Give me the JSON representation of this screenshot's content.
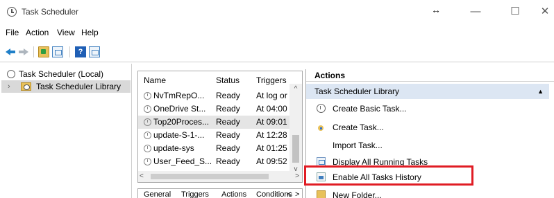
{
  "window": {
    "title": "Task Scheduler",
    "resize_glyph": "↔",
    "minimize": "—",
    "maximize": "☐",
    "close": "✕"
  },
  "menu": {
    "items": [
      "File",
      "Action",
      "View",
      "Help"
    ]
  },
  "toolbar": {
    "help_glyph": "?"
  },
  "tree": {
    "root_label": "Task Scheduler (Local)",
    "library_label": "Task Scheduler Library",
    "chevron": "›"
  },
  "tasklist": {
    "columns": [
      "Name",
      "Status",
      "Triggers"
    ],
    "rows": [
      {
        "name": "NvTmRepO...",
        "status": "Ready",
        "trigger": "At log or"
      },
      {
        "name": "OneDrive St...",
        "status": "Ready",
        "trigger": "At 04:00 ."
      },
      {
        "name": "Top20Proces...",
        "status": "Ready",
        "trigger": "At 09:01 |"
      },
      {
        "name": "update-S-1-...",
        "status": "Ready",
        "trigger": "At 12:28 ."
      },
      {
        "name": "update-sys",
        "status": "Ready",
        "trigger": "At 01:25 ."
      },
      {
        "name": "User_Feed_S...",
        "status": "Ready",
        "trigger": "At 09:52 |"
      }
    ],
    "selected_index": 2,
    "scroll_up": "^",
    "scroll_down": "v",
    "scroll_left": "<",
    "scroll_right": ">"
  },
  "bottom_tabs": {
    "items": [
      "General",
      "Triggers",
      "Actions",
      "Conditions"
    ],
    "nav_left": "<",
    "nav_right": ">"
  },
  "actions": {
    "header": "Actions",
    "section_title": "Task Scheduler Library",
    "section_arrow": "▲",
    "items": [
      {
        "label": "Create Basic Task...",
        "icon": "create-basic-task-icon"
      },
      {
        "label": "Create Task...",
        "icon": "create-task-icon"
      },
      {
        "label": "Import Task...",
        "icon": ""
      },
      {
        "label": "Display All Running Tasks",
        "icon": "display-running-tasks-icon"
      },
      {
        "label": "Enable All Tasks History",
        "icon": "enable-history-icon"
      },
      {
        "label": "New Folder...",
        "icon": "new-folder-icon"
      }
    ]
  },
  "colors": {
    "highlight": "#e01c24",
    "selection": "#dce6f3",
    "accent_blue": "#1f7fc8"
  }
}
